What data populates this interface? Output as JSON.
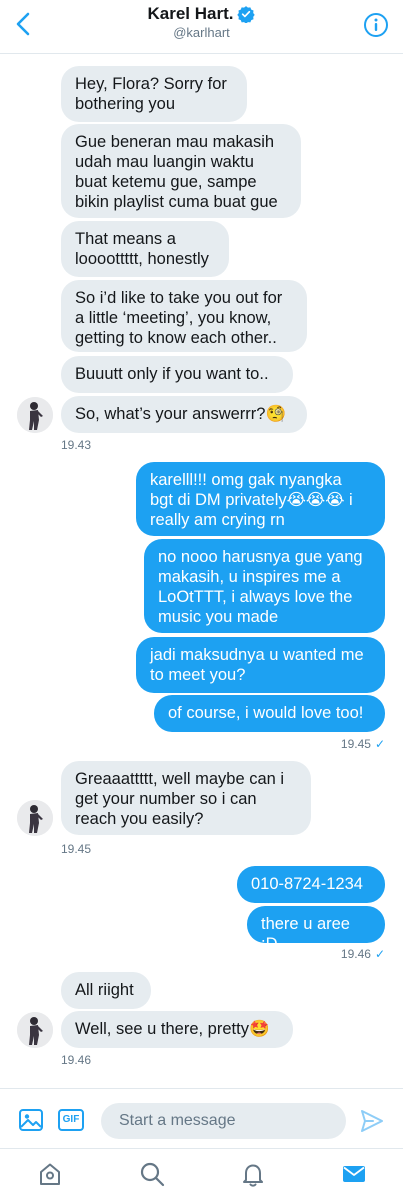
{
  "header": {
    "title": "Karel Hart.",
    "handle": "@karlhart"
  },
  "messages": [
    {
      "text": "Hey, Flora? Sorry for\nbothering you"
    },
    {
      "text": "Gue beneran mau makasih\nudah mau luangin waktu\nbuat ketemu gue, sampe\nbikin playlist cuma buat gue"
    },
    {
      "text": "That means a\nloooottttt, honestly"
    },
    {
      "text": "So i’d like to take you out for\na little ‘meeting’, you know,\ngetting to know each other.."
    },
    {
      "text": "Buuutt only if you want to.."
    },
    {
      "text": "So, what’s your answerrr?🧐"
    },
    {
      "text": "karelll!!! omg gak nyangka\nbgt di DM privately😭😭😭 i\nreally am crying rn"
    },
    {
      "text": "no nooo harusnya gue yang\nmakasih, u inspires me a\nLoOtTTT, i always love the\nmusic you made"
    },
    {
      "text": "jadi maksudnya u wanted me\nto meet you?"
    },
    {
      "text": "of course, i would love too!"
    },
    {
      "text": "Greaaattttt, well maybe can i\nget your number so i can\nreach you easily?"
    },
    {
      "text": "010-8724-1234"
    },
    {
      "text": "there u aree :D"
    },
    {
      "text": "All riight"
    },
    {
      "text": "Well, see u there, pretty🤩"
    }
  ],
  "timestamps": [
    "19.43",
    "19.45",
    "19.45",
    "19.46",
    "19.46"
  ],
  "read_check": "✓",
  "composer": {
    "gif_label": "GIF",
    "placeholder": "Start a message"
  },
  "colors": {
    "accent": "#1da1f2",
    "incoming_bubble": "#e6ecf0",
    "outgoing_bubble": "#1da1f2"
  },
  "icons": [
    "back-chevron-icon",
    "verified-badge-icon",
    "info-icon",
    "image-icon",
    "gif-icon",
    "send-icon",
    "home-icon",
    "search-icon",
    "notifications-icon",
    "messages-icon"
  ]
}
